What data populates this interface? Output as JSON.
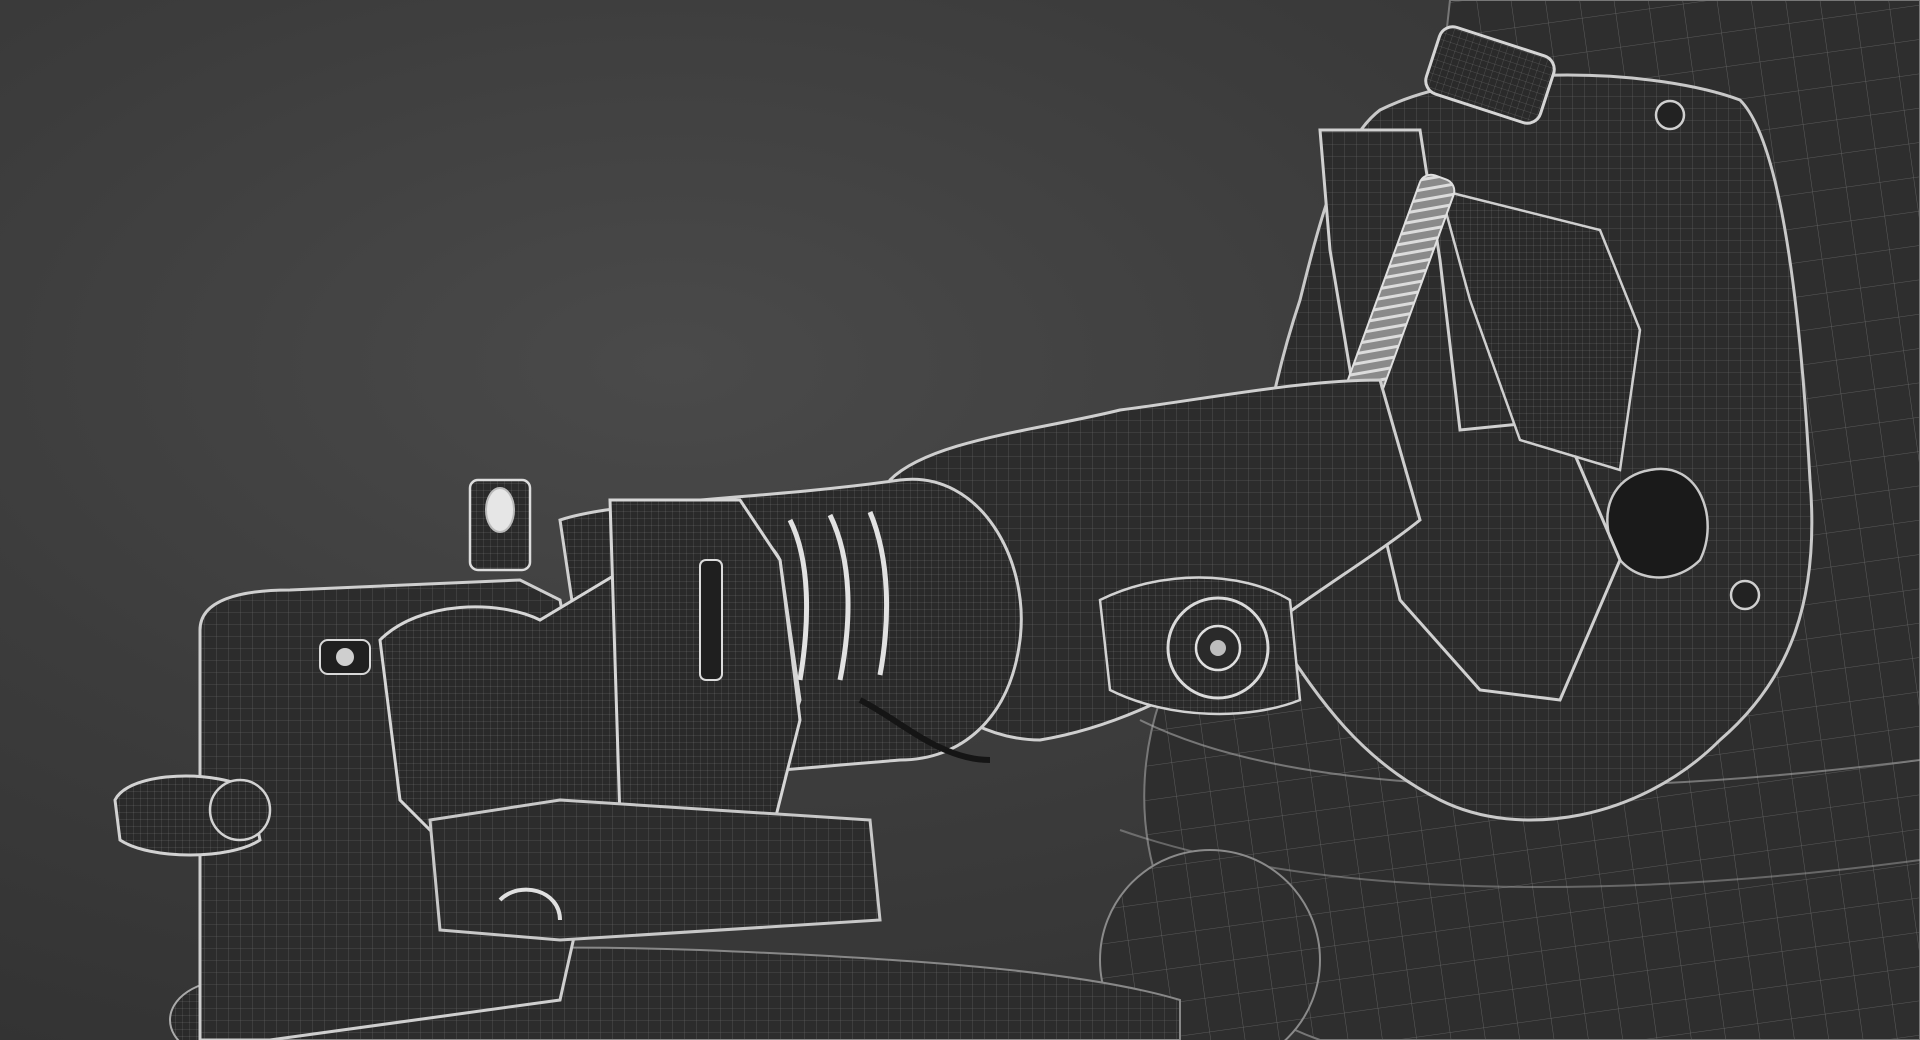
{
  "scene": {
    "background_color": "#3a3a3a",
    "wire_color": "#b8b8b8",
    "surface_color": "#2c2c2c",
    "surface_shade_color": "#1f1f1f",
    "highlight_color": "#d9d9d9"
  }
}
